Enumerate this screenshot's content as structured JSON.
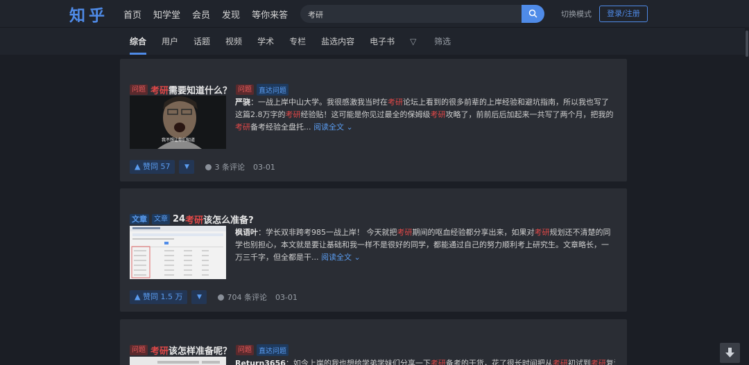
{
  "header": {
    "logo": "知乎",
    "nav": [
      "首页",
      "知学堂",
      "会员",
      "发现",
      "等你来答"
    ],
    "search_value": "考研",
    "mode_label": "切换模式",
    "login_label": "登录/注册"
  },
  "subnav": {
    "tabs": [
      "综合",
      "用户",
      "话题",
      "视频",
      "学术",
      "专栏",
      "盐选内容",
      "电子书"
    ],
    "filter_label": "筛选"
  },
  "results": [
    {
      "tag": "问题",
      "title_hl": "考研",
      "title_rest": "需要知道什么？",
      "extra_tag": "问题",
      "extra_link": "直达问题",
      "author": "严骁",
      "excerpt_parts": [
        "：一战上岸中山大学。我很感激我当时在",
        "考研",
        "论坛上看到的很多前辈的上岸经验和避坑指南，所以我也写了这篇2.8万字的",
        "考研",
        "经验贴！这可能是你见过最全的保姆级",
        "考研",
        "攻略了，前前后后加起来一共写了两个月，把我的",
        "考研",
        "备考经验全盘托..."
      ],
      "read_more": "阅读全文",
      "vote_label": "▲ 赞同 57",
      "comments": "3 条评论",
      "date": "03-01"
    },
    {
      "tag": "文章",
      "tag2": "文章",
      "title_pre": "24",
      "title_hl": "考研",
      "title_rest": "该怎么准备?",
      "author": "枫语叶",
      "excerpt_parts": [
        "：学长双非跨考985一战上岸！ 今天就把",
        "考研",
        "期间的呕血经验都分享出来，如果对",
        "考研",
        "规划还不清楚的同学也别担心，本文就是要让基础和我一样不是很好的同学，都能通过自己的努力顺利考上研究生。文章略长，一万三千字，但全都是干..."
      ],
      "read_more": "阅读全文",
      "vote_label": "▲ 赞同 1.5 万",
      "comments": "704 条评论",
      "date": "03-01"
    },
    {
      "tag": "问题",
      "title_hl": "考研",
      "title_rest": "该怎样准备呢？",
      "extra_tag": "问题",
      "extra_link": "直达问题",
      "author": "Return3656",
      "excerpt_parts": [
        "：如今上岸的我也想给学弟学妹们分享一下",
        "考研",
        "备考的干货，花了很长时间把从",
        "考研",
        "初试到",
        "考研",
        "复试的一系"
      ]
    }
  ],
  "thumb_caption": "我不想让你们知道",
  "colors": {
    "accent": "#4f8be8",
    "highlight": "#e04848",
    "card": "#2a2d34"
  }
}
